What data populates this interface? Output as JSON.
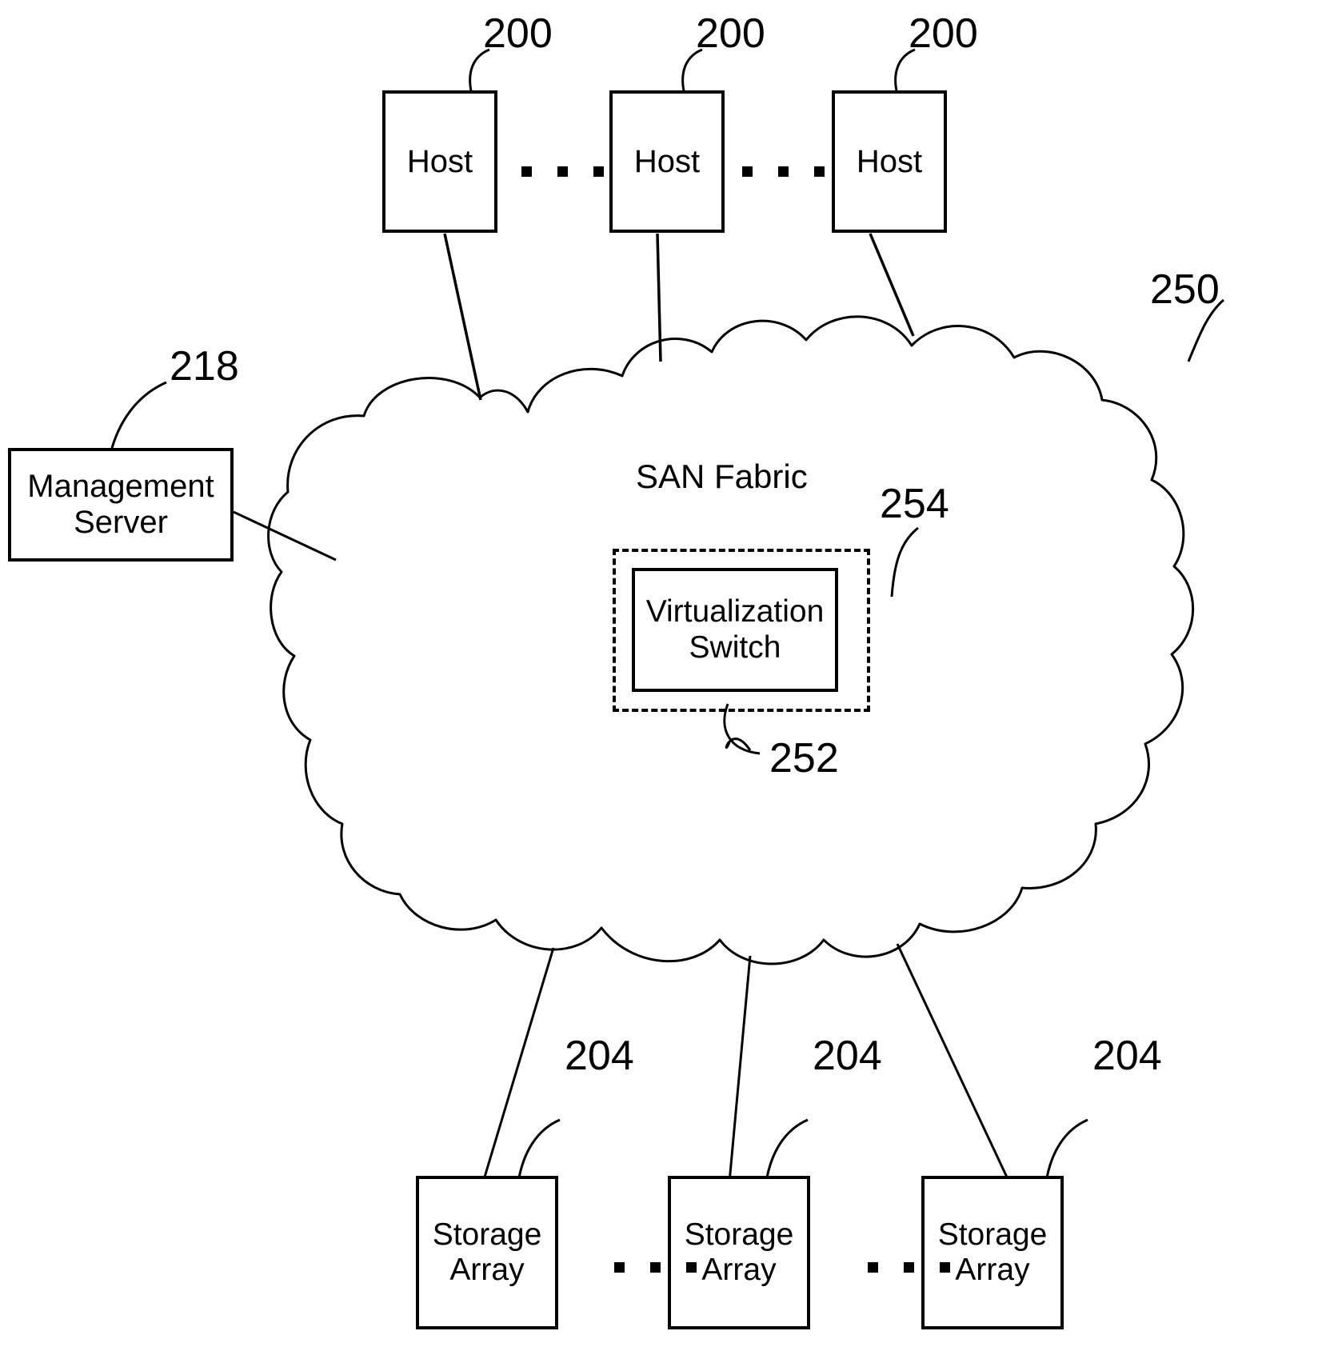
{
  "figure": {
    "fabric_label": "SAN Fabric",
    "hosts": [
      {
        "label": "Host",
        "ref": "200"
      },
      {
        "label": "Host",
        "ref": "200"
      },
      {
        "label": "Host",
        "ref": "200"
      }
    ],
    "storage_arrays": [
      {
        "label": "Storage\nArray",
        "line1": "Storage",
        "line2": "Array",
        "ref": "204"
      },
      {
        "label": "Storage\nArray",
        "line1": "Storage",
        "line2": "Array",
        "ref": "204"
      },
      {
        "label": "Storage\nArray",
        "line1": "Storage",
        "line2": "Array",
        "ref": "204"
      }
    ],
    "management_server": {
      "line1": "Management",
      "line2": "Server",
      "ref": "218"
    },
    "virtualization_switch": {
      "line1": "Virtualization",
      "line2": "Switch",
      "inner_ref": "252",
      "outer_ref": "254"
    },
    "cloud": {
      "ref": "250"
    },
    "ellipsis_glyph": "▪",
    "colors": {
      "stroke": "#000000",
      "background": "#ffffff"
    }
  }
}
